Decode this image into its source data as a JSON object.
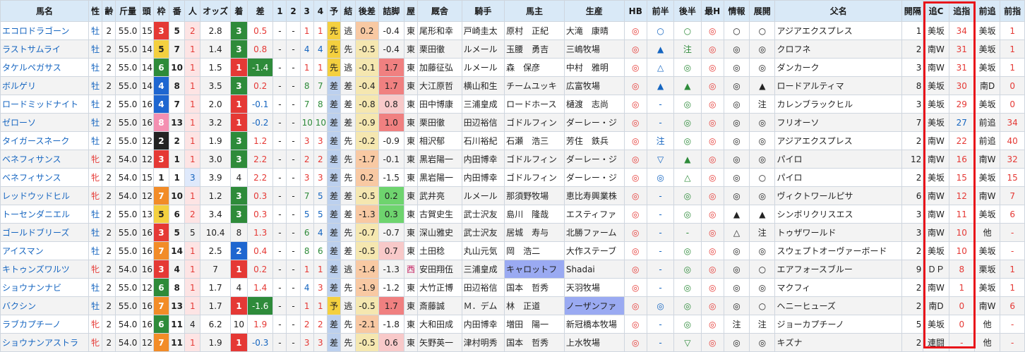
{
  "headers": [
    "馬名",
    "性",
    "齢",
    "斤量",
    "頭",
    "枠",
    "番",
    "人",
    "オッズ",
    "着",
    "差",
    "1",
    "2",
    "3",
    "4",
    "予",
    "結",
    "後差",
    "詰脚",
    "屋",
    "厩舎",
    "騎手",
    "馬主",
    "生産",
    "HB",
    "前半",
    "後半",
    "最H",
    "情報",
    "展開",
    "父名",
    "開隔",
    "追C",
    "追指",
    "前追",
    "前指"
  ],
  "rows": [
    {
      "name": "エコロドラゴーン",
      "sex": "牡",
      "age": "2",
      "kin": "55.0",
      "to": "15",
      "waku": "3",
      "ban": "5",
      "pop": "2",
      "odds": "2.8",
      "chaku": "3",
      "sa": "0.5",
      "c1": "-",
      "c2": "-",
      "c3": "1",
      "c4": "1",
      "yo": "先",
      "ketsu": "逃",
      "kosa": "0.2",
      "tsume": "-0.4",
      "ya": "東",
      "kyu": "尾形和幸",
      "kishu": "戸崎圭太",
      "owner": "原村　正紀",
      "sei": "大滝　康晴",
      "hb": "◎",
      "zen": "○",
      "kou": "○",
      "saih": "◎",
      "joho": "○",
      "tenkai": "○",
      "chichi": "アジアエクスプレス",
      "kan": "1",
      "oic": "美坂",
      "oisi": "34",
      "zoic": "美坂",
      "zoisi": "1"
    },
    {
      "name": "ラストサムライ",
      "sex": "牡",
      "age": "2",
      "kin": "55.0",
      "to": "14",
      "waku": "5",
      "ban": "7",
      "pop": "1",
      "odds": "1.4",
      "chaku": "3",
      "sa": "0.8",
      "c1": "-",
      "c2": "-",
      "c3": "4",
      "c4": "4",
      "yo": "先",
      "ketsu": "先",
      "kosa": "-0.5",
      "tsume": "-0.4",
      "ya": "東",
      "kyu": "栗田徹",
      "kishu": "ルメール",
      "owner": "玉腰　勇吉",
      "sei": "三嶋牧場",
      "hb": "◎",
      "zen": "▲",
      "kou": "注",
      "saih": "◎",
      "joho": "◎",
      "tenkai": "◎",
      "chichi": "クロフネ",
      "kan": "2",
      "oic": "南W",
      "oisi": "31",
      "zoic": "美坂",
      "zoisi": "1"
    },
    {
      "name": "タケルペガサス",
      "sex": "牡",
      "age": "2",
      "kin": "55.0",
      "to": "14",
      "waku": "6",
      "ban": "10",
      "pop": "1",
      "odds": "1.5",
      "chaku": "1",
      "sa": "-1.4",
      "c1": "-",
      "c2": "-",
      "c3": "1",
      "c4": "1",
      "yo": "先",
      "ketsu": "逃",
      "kosa": "-0.1",
      "tsume": "1.7",
      "ya": "東",
      "kyu": "加藤征弘",
      "kishu": "ルメール",
      "owner": "森　保彦",
      "sei": "中村　雅明",
      "hb": "◎",
      "zen": "△",
      "kou": "◎",
      "saih": "◎",
      "joho": "◎",
      "tenkai": "◎",
      "chichi": "ダンカーク",
      "kan": "3",
      "oic": "南W",
      "oisi": "31",
      "zoic": "美坂",
      "zoisi": "1"
    },
    {
      "name": "ボルゲリ",
      "sex": "牡",
      "age": "2",
      "kin": "55.0",
      "to": "14",
      "waku": "4",
      "ban": "8",
      "pop": "1",
      "odds": "3.5",
      "chaku": "3",
      "sa": "0.2",
      "c1": "-",
      "c2": "-",
      "c3": "8",
      "c4": "7",
      "yo": "差",
      "ketsu": "差",
      "kosa": "-0.4",
      "tsume": "1.7",
      "ya": "東",
      "kyu": "大江原哲",
      "kishu": "横山和生",
      "owner": "チームユッキ",
      "sei": "広富牧場",
      "hb": "◎",
      "zen": "▲",
      "kou": "▲",
      "saih": "◎",
      "joho": "◎",
      "tenkai": "▲",
      "chichi": "ロードアルティマ",
      "kan": "8",
      "oic": "美坂",
      "oisi": "30",
      "zoic": "南D",
      "zoisi": "0"
    },
    {
      "name": "ロードミッドナイト",
      "sex": "牡",
      "age": "2",
      "kin": "55.0",
      "to": "16",
      "waku": "4",
      "ban": "7",
      "pop": "1",
      "odds": "2.0",
      "chaku": "1",
      "sa": "-0.1",
      "c1": "-",
      "c2": "-",
      "c3": "7",
      "c4": "8",
      "yo": "差",
      "ketsu": "差",
      "kosa": "-0.8",
      "tsume": "0.8",
      "ya": "東",
      "kyu": "田中博康",
      "kishu": "三浦皇成",
      "owner": "ロードホース",
      "sei": "樋渡　志尚",
      "hb": "◎",
      "zen": "-",
      "kou": "◎",
      "saih": "◎",
      "joho": "◎",
      "tenkai": "注",
      "chichi": "カレンブラックヒル",
      "kan": "3",
      "oic": "美坂",
      "oisi": "29",
      "zoic": "美坂",
      "zoisi": "0"
    },
    {
      "name": "ゼローソ",
      "sex": "牡",
      "age": "2",
      "kin": "55.0",
      "to": "16",
      "waku": "8",
      "ban": "13",
      "pop": "1",
      "odds": "3.2",
      "chaku": "1",
      "sa": "-0.2",
      "c1": "-",
      "c2": "-",
      "c3": "10",
      "c4": "10",
      "yo": "差",
      "ketsu": "差",
      "kosa": "-0.9",
      "tsume": "1.0",
      "ya": "東",
      "kyu": "栗田徹",
      "kishu": "田辺裕信",
      "owner": "ゴドルフィン",
      "sei": "ダーレー・ジ",
      "hb": "◎",
      "zen": "-",
      "kou": "◎",
      "saih": "◎",
      "joho": "◎",
      "tenkai": "◎",
      "chichi": "フリオーソ",
      "kan": "7",
      "oic": "美坂",
      "oisi": "27",
      "zoic": "前追",
      "zoisi": "34"
    },
    {
      "name": "タイガースネーク",
      "sex": "牡",
      "age": "2",
      "kin": "55.0",
      "to": "12",
      "waku": "2",
      "ban": "2",
      "pop": "1",
      "odds": "1.9",
      "chaku": "3",
      "sa": "1.2",
      "c1": "-",
      "c2": "-",
      "c3": "3",
      "c4": "3",
      "yo": "差",
      "ketsu": "先",
      "kosa": "-0.2",
      "tsume": "-0.9",
      "ya": "東",
      "kyu": "相沢郁",
      "kishu": "石川裕紀",
      "owner": "石瀬　浩三",
      "sei": "芳住　鉄兵",
      "hb": "◎",
      "zen": "注",
      "kou": "◎",
      "saih": "◎",
      "joho": "◎",
      "tenkai": "◎",
      "chichi": "アジアエクスプレス",
      "kan": "2",
      "oic": "南W",
      "oisi": "22",
      "zoic": "前追",
      "zoisi": "40"
    },
    {
      "name": "ベネフィサンス",
      "sex": "牝",
      "age": "2",
      "kin": "54.0",
      "to": "12",
      "waku": "3",
      "ban": "1",
      "pop": "1",
      "odds": "3.0",
      "chaku": "3",
      "sa": "2.2",
      "c1": "-",
      "c2": "-",
      "c3": "2",
      "c4": "2",
      "yo": "差",
      "ketsu": "先",
      "kosa": "-1.7",
      "tsume": "-0.1",
      "ya": "東",
      "kyu": "黒岩陽一",
      "kishu": "内田博幸",
      "owner": "ゴドルフィン",
      "sei": "ダーレー・ジ",
      "hb": "◎",
      "zen": "▽",
      "kou": "▲",
      "saih": "◎",
      "joho": "◎",
      "tenkai": "◎",
      "chichi": "パイロ",
      "kan": "12",
      "oic": "南W",
      "oisi": "16",
      "zoic": "南W",
      "zoisi": "32"
    },
    {
      "name": "ベネフィサンス",
      "sex": "牝",
      "age": "2",
      "kin": "54.0",
      "to": "15",
      "waku": "1",
      "ban": "1",
      "pop": "3",
      "odds": "3.9",
      "chaku": "4",
      "sa": "2.2",
      "c1": "-",
      "c2": "-",
      "c3": "3",
      "c4": "3",
      "yo": "差",
      "ketsu": "先",
      "kosa": "0.2",
      "tsume": "-1.5",
      "ya": "東",
      "kyu": "黒岩陽一",
      "kishu": "内田博幸",
      "owner": "ゴドルフィン",
      "sei": "ダーレー・ジ",
      "hb": "◎",
      "zen": "◎",
      "kou": "△",
      "saih": "◎",
      "joho": "◎",
      "tenkai": "○",
      "chichi": "パイロ",
      "kan": "2",
      "oic": "美坂",
      "oisi": "15",
      "zoic": "美坂",
      "zoisi": "15"
    },
    {
      "name": "レッドウッドヒル",
      "sex": "牝",
      "age": "2",
      "kin": "54.0",
      "to": "12",
      "waku": "7",
      "ban": "10",
      "pop": "1",
      "odds": "1.2",
      "chaku": "3",
      "sa": "0.3",
      "c1": "-",
      "c2": "-",
      "c3": "7",
      "c4": "5",
      "yo": "差",
      "ketsu": "差",
      "kosa": "-0.5",
      "tsume": "0.2",
      "ya": "東",
      "kyu": "武井亮",
      "kishu": "ルメール",
      "owner": "那須野牧場",
      "sei": "恵比寿興業株",
      "hb": "◎",
      "zen": "-",
      "kou": "◎",
      "saih": "◎",
      "joho": "◎",
      "tenkai": "◎",
      "chichi": "ヴィクトワールピサ",
      "kan": "6",
      "oic": "南W",
      "oisi": "12",
      "zoic": "南W",
      "zoisi": "7"
    },
    {
      "name": "トーセンダニエル",
      "sex": "牡",
      "age": "2",
      "kin": "55.0",
      "to": "13",
      "waku": "5",
      "ban": "6",
      "pop": "2",
      "odds": "3.4",
      "chaku": "3",
      "sa": "0.3",
      "c1": "-",
      "c2": "-",
      "c3": "5",
      "c4": "5",
      "yo": "差",
      "ketsu": "差",
      "kosa": "-1.3",
      "tsume": "0.3",
      "ya": "東",
      "kyu": "古賀史生",
      "kishu": "武士沢友",
      "owner": "島川　隆哉",
      "sei": "エスティファ",
      "hb": "◎",
      "zen": "-",
      "kou": "◎",
      "saih": "◎",
      "joho": "▲",
      "tenkai": "▲",
      "chichi": "シンボリクリスエス",
      "kan": "3",
      "oic": "南W",
      "oisi": "11",
      "zoic": "美坂",
      "zoisi": "6"
    },
    {
      "name": "ゴールドブリーズ",
      "sex": "牡",
      "age": "2",
      "kin": "55.0",
      "to": "16",
      "waku": "3",
      "ban": "5",
      "pop": "5",
      "odds": "10.4",
      "chaku": "8",
      "sa": "1.3",
      "c1": "-",
      "c2": "-",
      "c3": "6",
      "c4": "4",
      "yo": "差",
      "ketsu": "先",
      "kosa": "-0.7",
      "tsume": "-0.7",
      "ya": "東",
      "kyu": "深山雅史",
      "kishu": "武士沢友",
      "owner": "居城　寿与",
      "sei": "北勝ファーム",
      "hb": "◎",
      "zen": "-",
      "kou": "-",
      "saih": "◎",
      "joho": "△",
      "tenkai": "注",
      "chichi": "トゥザワールド",
      "kan": "3",
      "oic": "南W",
      "oisi": "10",
      "zoic": "他",
      "zoisi": "-"
    },
    {
      "name": "アイスマン",
      "sex": "牡",
      "age": "2",
      "kin": "55.0",
      "to": "16",
      "waku": "7",
      "ban": "14",
      "pop": "1",
      "odds": "2.5",
      "chaku": "2",
      "sa": "0.4",
      "c1": "-",
      "c2": "-",
      "c3": "8",
      "c4": "6",
      "yo": "差",
      "ketsu": "差",
      "kosa": "-0.5",
      "tsume": "0.7",
      "ya": "東",
      "kyu": "土田稔",
      "kishu": "丸山元気",
      "owner": "岡　浩二",
      "sei": "大作ステーブ",
      "hb": "◎",
      "zen": "-",
      "kou": "◎",
      "saih": "◎",
      "joho": "◎",
      "tenkai": "◎",
      "chichi": "スウェプトオーヴァーボード",
      "kan": "2",
      "oic": "美坂",
      "oisi": "10",
      "zoic": "美坂",
      "zoisi": "-"
    },
    {
      "name": "キトゥンズワルツ",
      "sex": "牝",
      "age": "2",
      "kin": "54.0",
      "to": "16",
      "waku": "3",
      "ban": "4",
      "pop": "1",
      "odds": "7",
      "chaku": "1",
      "sa": "0.2",
      "c1": "-",
      "c2": "-",
      "c3": "1",
      "c4": "1",
      "yo": "差",
      "ketsu": "逃",
      "kosa": "-1.4",
      "tsume": "-1.3",
      "ya": "西",
      "kyu": "安田翔伍",
      "kishu": "三浦皇成",
      "owner": "キャロットフ",
      "sei": "Shadai",
      "hb": "◎",
      "zen": "-",
      "kou": "◎",
      "saih": "◎",
      "joho": "◎",
      "tenkai": "○",
      "chichi": "エアフォースブルー",
      "kan": "9",
      "oic": "ＤＰ",
      "oisi": "8",
      "zoic": "栗坂",
      "zoisi": "1"
    },
    {
      "name": "ショウナンナビ",
      "sex": "牡",
      "age": "2",
      "kin": "55.0",
      "to": "12",
      "waku": "6",
      "ban": "8",
      "pop": "1",
      "odds": "1.7",
      "chaku": "4",
      "sa": "1.4",
      "c1": "-",
      "c2": "-",
      "c3": "4",
      "c4": "3",
      "yo": "差",
      "ketsu": "先",
      "kosa": "-1.9",
      "tsume": "-1.2",
      "ya": "東",
      "kyu": "大竹正博",
      "kishu": "田辺裕信",
      "owner": "国本　哲秀",
      "sei": "天羽牧場",
      "hb": "◎",
      "zen": "-",
      "kou": "◎",
      "saih": "◎",
      "joho": "◎",
      "tenkai": "◎",
      "chichi": "マクフィ",
      "kan": "2",
      "oic": "南W",
      "oisi": "1",
      "zoic": "美坂",
      "zoisi": "1"
    },
    {
      "name": "バクシン",
      "sex": "牡",
      "age": "2",
      "kin": "55.0",
      "to": "16",
      "waku": "7",
      "ban": "13",
      "pop": "1",
      "odds": "1.7",
      "chaku": "1",
      "sa": "-1.6",
      "c1": "-",
      "c2": "-",
      "c3": "1",
      "c4": "1",
      "yo": "予",
      "ketsu": "逃",
      "kosa": "-0.5",
      "tsume": "1.7",
      "ya": "東",
      "kyu": "斎藤誠",
      "kishu": "Ｍ．デム",
      "owner": "林　正道",
      "sei": "ノーザンファ",
      "hb": "◎",
      "zen": "◎",
      "kou": "◎",
      "saih": "◎",
      "joho": "◎",
      "tenkai": "○",
      "chichi": "ヘニーヒューズ",
      "kan": "2",
      "oic": "南D",
      "oisi": "0",
      "zoic": "南W",
      "zoisi": "6"
    },
    {
      "name": "ラブカプチーノ",
      "sex": "牝",
      "age": "2",
      "kin": "54.0",
      "to": "16",
      "waku": "6",
      "ban": "11",
      "pop": "4",
      "odds": "6.2",
      "chaku": "10",
      "sa": "1.9",
      "c1": "-",
      "c2": "-",
      "c3": "2",
      "c4": "2",
      "yo": "差",
      "ketsu": "先",
      "kosa": "-2.1",
      "tsume": "-1.8",
      "ya": "東",
      "kyu": "大和田成",
      "kishu": "内田博幸",
      "owner": "増田　陽一",
      "sei": "新冠橋本牧場",
      "hb": "◎",
      "zen": "-",
      "kou": "◎",
      "saih": "◎",
      "joho": "注",
      "tenkai": "注",
      "chichi": "ジョーカプチーノ",
      "kan": "5",
      "oic": "美坂",
      "oisi": "0",
      "zoic": "他",
      "zoisi": "-"
    },
    {
      "name": "ショウナンアストラ",
      "sex": "牝",
      "age": "2",
      "kin": "54.0",
      "to": "12",
      "waku": "7",
      "ban": "11",
      "pop": "1",
      "odds": "1.9",
      "chaku": "1",
      "sa": "-0.3",
      "c1": "-",
      "c2": "-",
      "c3": "3",
      "c4": "3",
      "yo": "差",
      "ketsu": "先",
      "kosa": "-0.5",
      "tsume": "0.6",
      "ya": "東",
      "kyu": "矢野英一",
      "kishu": "津村明秀",
      "owner": "国本　哲秀",
      "sei": "上水牧場",
      "hb": "◎",
      "zen": "-",
      "kou": "▽",
      "saih": "◎",
      "joho": "◎",
      "tenkai": "◎",
      "chichi": "キズナ",
      "kan": "2",
      "oic": "連闘",
      "oisi": "-",
      "zoic": "他",
      "zoisi": "-"
    }
  ]
}
